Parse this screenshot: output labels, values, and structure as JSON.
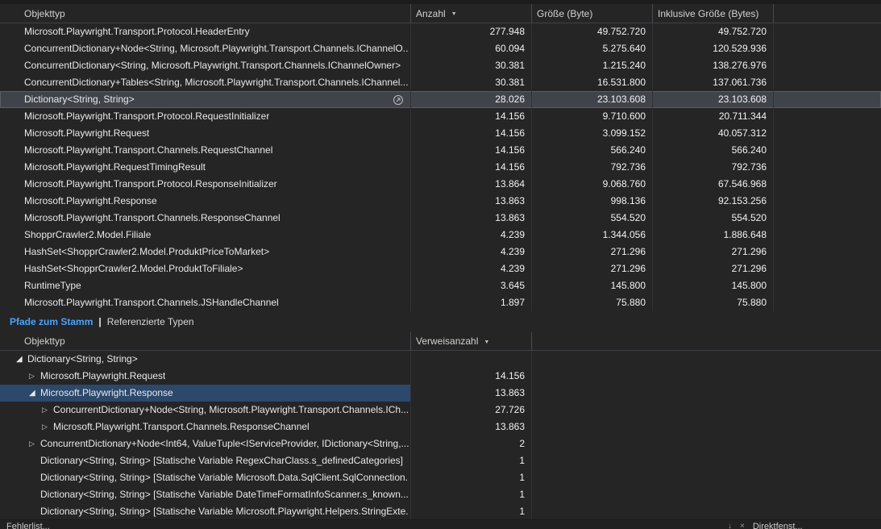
{
  "colors": {
    "selection_top": "#40444a",
    "selection_bottom": "#2c486b",
    "tab_active": "#4aa3ff"
  },
  "top_table": {
    "columns": [
      "Objekttyp",
      "Anzahl",
      "Größe (Byte)",
      "Inklusive Größe (Bytes)"
    ],
    "sort_column": "Anzahl",
    "sort_direction": "descending",
    "rows": [
      {
        "type": "Microsoft.Playwright.Transport.Protocol.HeaderEntry",
        "count": "277.948",
        "size": "49.752.720",
        "inclusive_size": "49.752.720"
      },
      {
        "type": "ConcurrentDictionary+Node<String, Microsoft.Playwright.Transport.Channels.IChannelO...",
        "count": "60.094",
        "size": "5.275.640",
        "inclusive_size": "120.529.936"
      },
      {
        "type": "ConcurrentDictionary<String, Microsoft.Playwright.Transport.Channels.IChannelOwner>",
        "count": "30.381",
        "size": "1.215.240",
        "inclusive_size": "138.276.976"
      },
      {
        "type": "ConcurrentDictionary+Tables<String, Microsoft.Playwright.Transport.Channels.IChannel...",
        "count": "30.381",
        "size": "16.531.800",
        "inclusive_size": "137.061.736"
      },
      {
        "type": "Dictionary<String, String>",
        "count": "28.026",
        "size": "23.103.608",
        "inclusive_size": "23.103.608",
        "selected": true,
        "icon": "view-instances"
      },
      {
        "type": "Microsoft.Playwright.Transport.Protocol.RequestInitializer",
        "count": "14.156",
        "size": "9.710.600",
        "inclusive_size": "20.711.344"
      },
      {
        "type": "Microsoft.Playwright.Request",
        "count": "14.156",
        "size": "3.099.152",
        "inclusive_size": "40.057.312"
      },
      {
        "type": "Microsoft.Playwright.Transport.Channels.RequestChannel",
        "count": "14.156",
        "size": "566.240",
        "inclusive_size": "566.240"
      },
      {
        "type": "Microsoft.Playwright.RequestTimingResult",
        "count": "14.156",
        "size": "792.736",
        "inclusive_size": "792.736"
      },
      {
        "type": "Microsoft.Playwright.Transport.Protocol.ResponseInitializer",
        "count": "13.864",
        "size": "9.068.760",
        "inclusive_size": "67.546.968"
      },
      {
        "type": "Microsoft.Playwright.Response",
        "count": "13.863",
        "size": "998.136",
        "inclusive_size": "92.153.256"
      },
      {
        "type": "Microsoft.Playwright.Transport.Channels.ResponseChannel",
        "count": "13.863",
        "size": "554.520",
        "inclusive_size": "554.520"
      },
      {
        "type": "ShopprCrawler2.Model.Filiale",
        "count": "4.239",
        "size": "1.344.056",
        "inclusive_size": "1.886.648"
      },
      {
        "type": "HashSet<ShopprCrawler2.Model.ProduktPriceToMarket>",
        "count": "4.239",
        "size": "271.296",
        "inclusive_size": "271.296"
      },
      {
        "type": "HashSet<ShopprCrawler2.Model.ProduktToFiliale>",
        "count": "4.239",
        "size": "271.296",
        "inclusive_size": "271.296"
      },
      {
        "type": "RuntimeType",
        "count": "3.645",
        "size": "145.800",
        "inclusive_size": "145.800"
      },
      {
        "type": "Microsoft.Playwright.Transport.Channels.JSHandleChannel",
        "count": "1.897",
        "size": "75.880",
        "inclusive_size": "75.880"
      }
    ]
  },
  "tabs": [
    {
      "label": "Pfade zum Stamm",
      "active": true
    },
    {
      "label": "Referenzierte Typen",
      "active": false
    }
  ],
  "tab_separator": "|",
  "bottom_table": {
    "columns": [
      "Objekttyp",
      "Verweisanzahl"
    ],
    "sort_column": "Verweisanzahl",
    "sort_direction": "descending",
    "rows": [
      {
        "type": "Dictionary<String, String>",
        "count": "",
        "level": 0,
        "expander": "expanded"
      },
      {
        "type": "Microsoft.Playwright.Request",
        "count": "14.156",
        "level": 1,
        "expander": "collapsed"
      },
      {
        "type": "Microsoft.Playwright.Response",
        "count": "13.863",
        "level": 1,
        "expander": "expanded",
        "selected": true
      },
      {
        "type": "ConcurrentDictionary+Node<String, Microsoft.Playwright.Transport.Channels.ICh...",
        "count": "27.726",
        "level": 2,
        "expander": "collapsed"
      },
      {
        "type": "Microsoft.Playwright.Transport.Channels.ResponseChannel",
        "count": "13.863",
        "level": 2,
        "expander": "collapsed"
      },
      {
        "type": "ConcurrentDictionary+Node<Int64, ValueTuple<IServiceProvider, IDictionary<String,...",
        "count": "2",
        "level": 1,
        "expander": "collapsed"
      },
      {
        "type": "Dictionary<String, String> [Statische Variable RegexCharClass.s_definedCategories]",
        "count": "1",
        "level": 1,
        "expander": "none"
      },
      {
        "type": "Dictionary<String, String> [Statische Variable Microsoft.Data.SqlClient.SqlConnection...",
        "count": "1",
        "level": 1,
        "expander": "none"
      },
      {
        "type": "Dictionary<String, String> [Statische Variable DateTimeFormatInfoScanner.s_known...",
        "count": "1",
        "level": 1,
        "expander": "none"
      },
      {
        "type": "Dictionary<String, String> [Statische Variable Microsoft.Playwright.Helpers.StringExte...",
        "count": "1",
        "level": 1,
        "expander": "none"
      }
    ]
  },
  "status_bar": {
    "left": "Fehlerlist...",
    "right": "Direktfenst..."
  }
}
